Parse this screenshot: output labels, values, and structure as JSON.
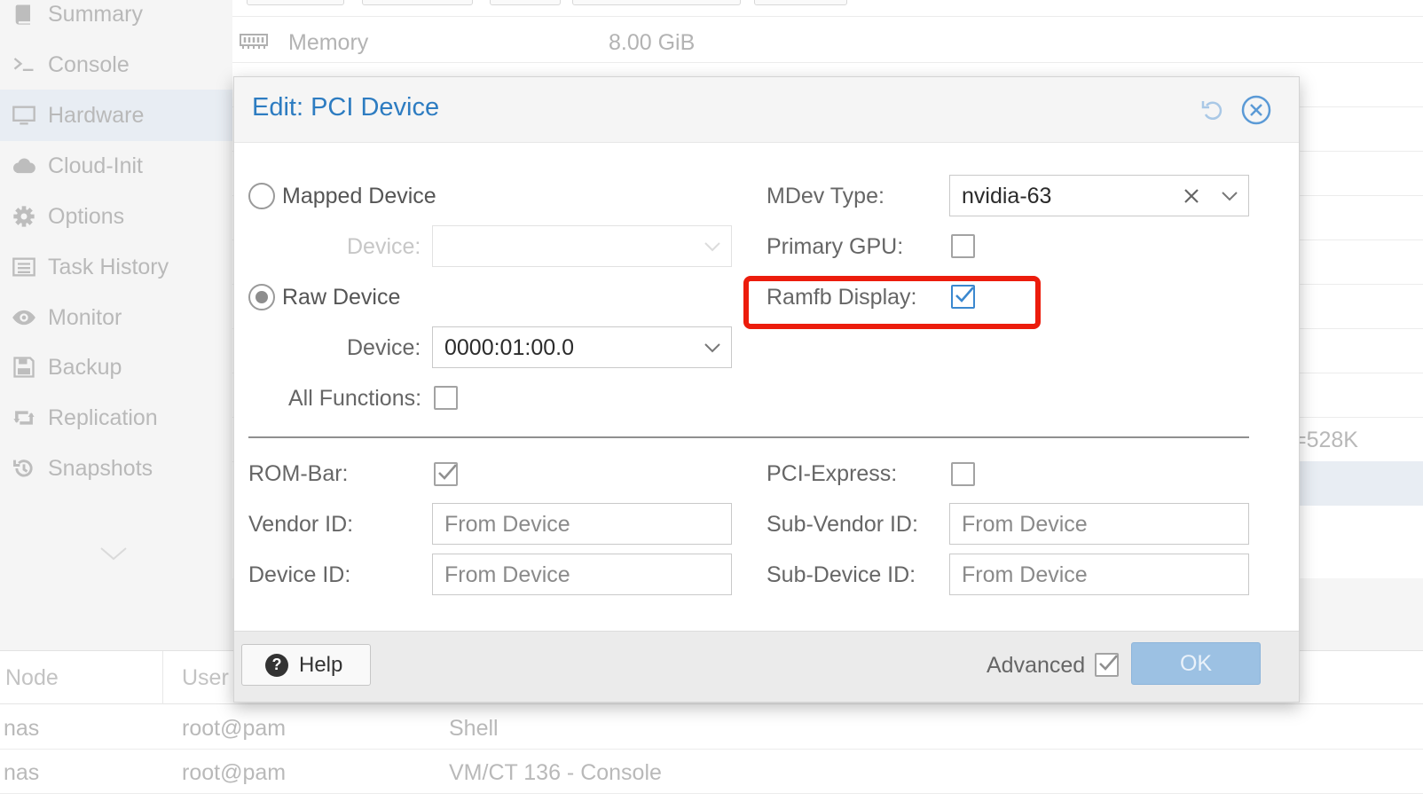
{
  "sidebar": {
    "items": [
      {
        "label": "Summary",
        "icon": "book-icon"
      },
      {
        "label": "Console",
        "icon": "terminal-icon"
      },
      {
        "label": "Hardware",
        "icon": "desktop-icon"
      },
      {
        "label": "Cloud-Init",
        "icon": "cloud-icon"
      },
      {
        "label": "Options",
        "icon": "gear-icon"
      },
      {
        "label": "Task History",
        "icon": "list-icon"
      },
      {
        "label": "Monitor",
        "icon": "eye-icon"
      },
      {
        "label": "Backup",
        "icon": "floppy-icon"
      },
      {
        "label": "Replication",
        "icon": "retweet-icon"
      },
      {
        "label": "Snapshots",
        "icon": "history-icon"
      }
    ]
  },
  "hardware": {
    "memory_label": "Memory",
    "memory_value": "8.00 GiB",
    "partial_value": "=528K"
  },
  "task_log": {
    "columns": {
      "node": "Node",
      "user": "User"
    },
    "rows": [
      {
        "node": "nas",
        "user": "root@pam",
        "description": "Shell"
      },
      {
        "node": "nas",
        "user": "root@pam",
        "description": "VM/CT 136 - Console"
      }
    ]
  },
  "dialog": {
    "title": "Edit: PCI Device",
    "mapped_device_label": "Mapped Device",
    "mapped_device_field_label": "Device:",
    "raw_device_label": "Raw Device",
    "raw_device_field_label": "Device:",
    "raw_device_value": "0000:01:00.0",
    "all_functions_label": "All Functions:",
    "all_functions_checked": false,
    "mdev_type_label": "MDev Type:",
    "mdev_type_value": "nvidia-63",
    "primary_gpu_label": "Primary GPU:",
    "primary_gpu_checked": false,
    "ramfb_label": "Ramfb Display:",
    "ramfb_checked": true,
    "rom_bar_label": "ROM-Bar:",
    "rom_bar_checked": true,
    "pci_express_label": "PCI-Express:",
    "pci_express_checked": false,
    "vendor_id_label": "Vendor ID:",
    "vendor_id_placeholder": "From Device",
    "device_id_label": "Device ID:",
    "device_id_placeholder": "From Device",
    "sub_vendor_id_label": "Sub-Vendor ID:",
    "sub_vendor_id_placeholder": "From Device",
    "sub_device_id_label": "Sub-Device ID:",
    "sub_device_id_placeholder": "From Device",
    "help_label": "Help",
    "advanced_label": "Advanced",
    "advanced_checked": true,
    "ok_label": "OK"
  },
  "colors": {
    "accent": "#2d7cc1",
    "highlight": "#ec1c0c",
    "ok_button": "#9cc1e3"
  }
}
